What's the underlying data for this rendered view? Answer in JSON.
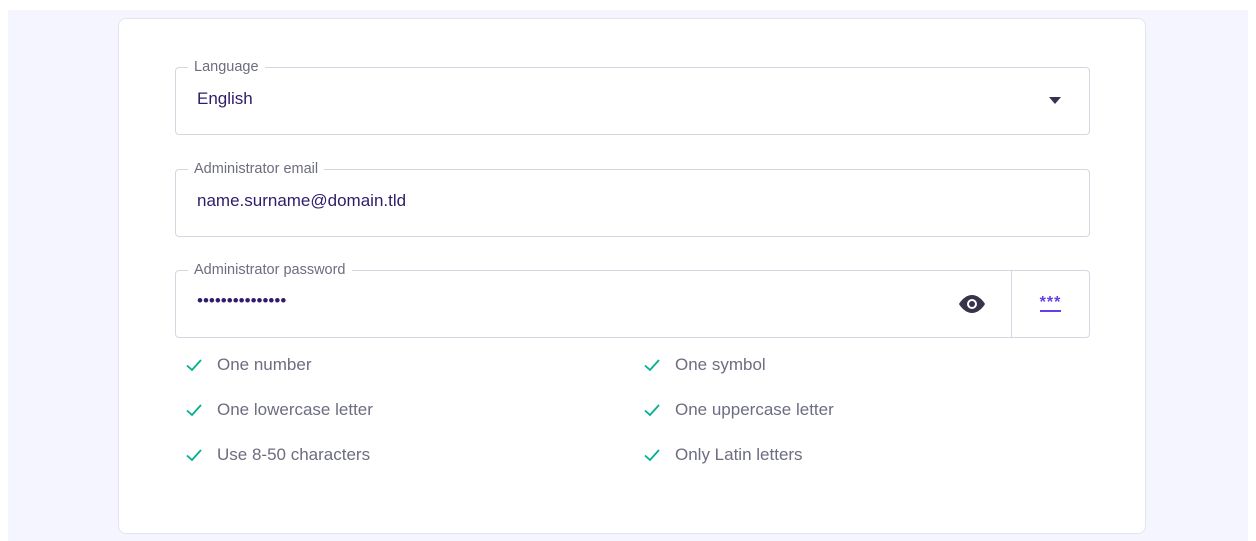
{
  "form": {
    "language": {
      "label": "Language",
      "value": "English"
    },
    "email": {
      "label": "Administrator email",
      "value": "name.surname@domain.tld"
    },
    "password": {
      "label": "Administrator password",
      "value": "•••••••••••••••",
      "generate_glyph": "***"
    }
  },
  "requirements": [
    {
      "text": "One number",
      "met": true
    },
    {
      "text": "One symbol",
      "met": true
    },
    {
      "text": "One lowercase letter",
      "met": true
    },
    {
      "text": "One uppercase letter",
      "met": true
    },
    {
      "text": "Use 8-50 characters",
      "met": true
    },
    {
      "text": "Only Latin letters",
      "met": true
    }
  ],
  "colors": {
    "accent": "#673de6",
    "success": "#00b090",
    "text": "#2f1c6a",
    "muted": "#6c6d80"
  }
}
